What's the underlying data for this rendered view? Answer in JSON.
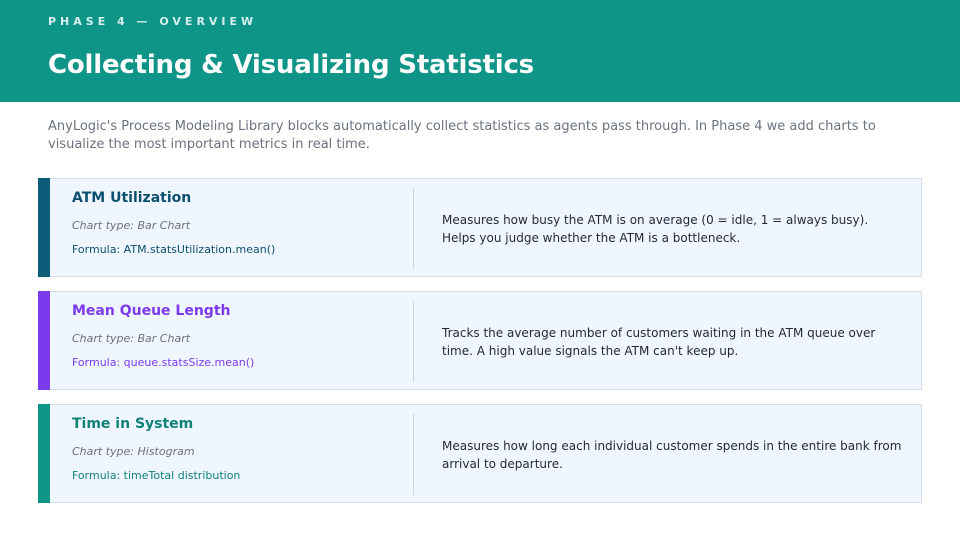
{
  "header": {
    "phase_label": "PHASE 4 — OVERVIEW",
    "title": "Collecting & Visualizing Statistics"
  },
  "intro": "AnyLogic's Process Modeling Library blocks automatically collect statistics as agents pass through. In Phase 4 we add charts to visualize the most important metrics in real time.",
  "cards": [
    {
      "name": "ATM Utilization",
      "chart_type": "Chart type: Bar Chart",
      "formula": "Formula: ATM.statsUtilization.mean()",
      "description": "Measures how busy the ATM is on average (0 = idle, 1 = always busy). Helps you judge whether the ATM is a bottleneck.",
      "accent": "#0d5c7a",
      "text_color": "#0d4f6e"
    },
    {
      "name": "Mean Queue Length",
      "chart_type": "Chart type: Bar Chart",
      "formula": "Formula: queue.statsSize.mean()",
      "description": "Tracks the average number of customers waiting in the ATM queue over time. A high value signals the ATM can't keep up.",
      "accent": "#7c3aed",
      "text_color": "#7c3aed"
    },
    {
      "name": "Time in System",
      "chart_type": "Chart type: Histogram",
      "formula": "Formula: timeTotal distribution",
      "description": "Measures how long each individual customer spends in the entire bank from arrival to departure.",
      "accent": "#0f9488",
      "text_color": "#0f8278"
    }
  ]
}
